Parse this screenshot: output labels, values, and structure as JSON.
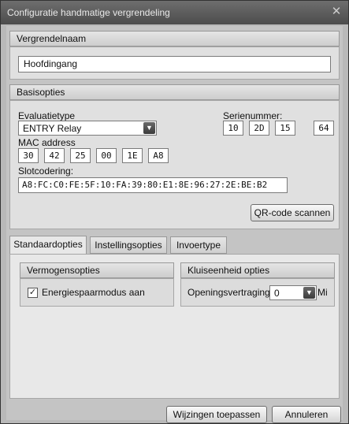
{
  "window": {
    "title": "Configuratie handmatige vergrendeling",
    "close_glyph": "✕"
  },
  "lock_name": {
    "header": "Vergrendelnaam",
    "value": "Hoofdingang"
  },
  "basic_options": {
    "header": "Basisopties",
    "evaluation_type_label": "Evaluatietype",
    "evaluation_type_value": "ENTRY Relay",
    "serial_label": "Serienummer:",
    "serial": [
      "10",
      "2D",
      "15",
      "64"
    ],
    "mac_label": "MAC address",
    "mac": [
      "30",
      "42",
      "25",
      "00",
      "1E",
      "A8"
    ],
    "lock_code_label": "Slotcodering:",
    "lock_code_value": "A8:FC:C0:FE:5F:10:FA:39:80:E1:8E:96:27:2E:BE:B2",
    "scan_qr_button": "QR-code scannen"
  },
  "tabs": [
    "Standaardopties",
    "Instellingsopties",
    "Invoertype"
  ],
  "power_options": {
    "header": "Vermogensopties",
    "energy_saving_label": "Energiespaarmodus aan",
    "energy_saving_checked": true
  },
  "locker_options": {
    "header": "Kluiseenheid opties",
    "opening_delay_label": "Openingsvertraging",
    "opening_delay_value": "0",
    "opening_delay_unit": "Mi"
  },
  "footer": {
    "apply_button": "Wijzingen toepassen",
    "cancel_button": "Annuleren"
  }
}
